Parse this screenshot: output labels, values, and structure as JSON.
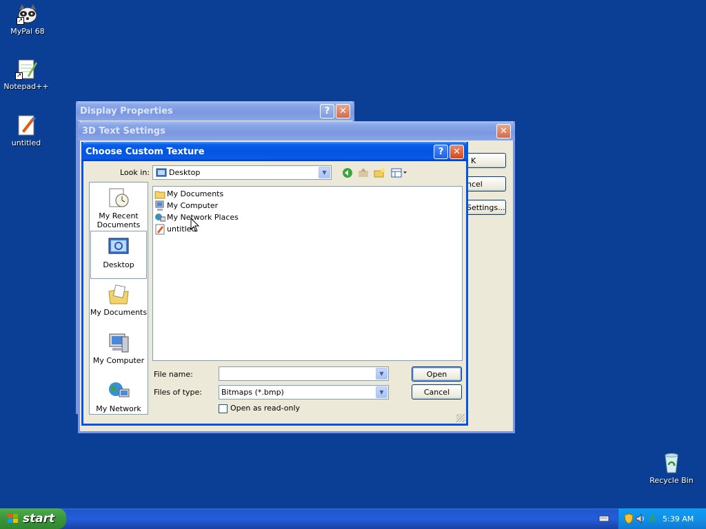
{
  "desktop": {
    "icons": [
      {
        "label": "MyPal 68"
      },
      {
        "label": "Notepad++"
      },
      {
        "label": "untitled"
      },
      {
        "label": "Recycle Bin"
      }
    ]
  },
  "display_properties": {
    "title": "Display Properties",
    "help": "?",
    "close": "✕"
  },
  "text3d": {
    "title": "3D Text Settings",
    "close": "✕",
    "ok_partial": "K",
    "cancel_partial": "ncel",
    "settings_partial": "Settings..."
  },
  "dialog": {
    "title": "Choose Custom Texture",
    "help": "?",
    "close": "✕",
    "look_in_label": "Look in:",
    "look_in_value": "Desktop",
    "places": [
      {
        "label": "My Recent Documents"
      },
      {
        "label": "Desktop"
      },
      {
        "label": "My Documents"
      },
      {
        "label": "My Computer"
      },
      {
        "label": "My Network"
      }
    ],
    "files": [
      {
        "label": "My Documents"
      },
      {
        "label": "My Computer"
      },
      {
        "label": "My Network Places"
      },
      {
        "label": "untitled"
      }
    ],
    "file_name_label": "File name:",
    "file_name_value": "",
    "file_type_label": "Files of type:",
    "file_type_value": "Bitmaps (*.bmp)",
    "readonly_label": "Open as read-only",
    "open_label": "Open",
    "cancel_label": "Cancel"
  },
  "taskbar": {
    "start_label": "start",
    "clock": "5:39 AM"
  }
}
